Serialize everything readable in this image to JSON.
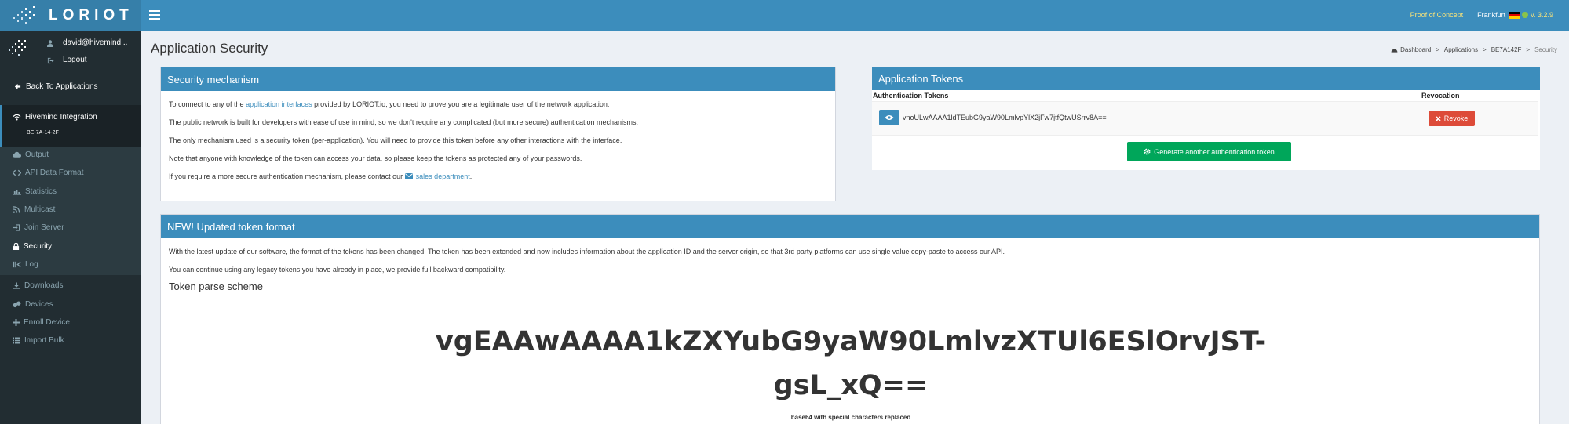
{
  "brand": {
    "name": "LORIOT"
  },
  "topbar": {
    "poc_label": "Proof of Concept",
    "region": "Frankfurt",
    "version": "v. 3.2.9",
    "menu_icon": "hamburger-icon"
  },
  "user": {
    "email": "david@hivemind...",
    "logout_label": "Logout"
  },
  "sidebar": {
    "back_label": "Back To Applications",
    "app_name": "Hivemind Integration",
    "app_id": "BE-7A-14-2F",
    "items": [
      {
        "label": "Output",
        "icon": "cloud-icon"
      },
      {
        "label": "API Data Format",
        "icon": "code-icon"
      },
      {
        "label": "Statistics",
        "icon": "bar-chart-icon"
      },
      {
        "label": "Multicast",
        "icon": "rss-icon"
      },
      {
        "label": "Join Server",
        "icon": "login-icon"
      },
      {
        "label": "Security",
        "icon": "lock-icon"
      },
      {
        "label": "Log",
        "icon": "log-icon"
      },
      {
        "label": "Downloads",
        "icon": "download-icon"
      },
      {
        "label": "Devices",
        "icon": "devices-icon"
      },
      {
        "label": "Enroll Device",
        "icon": "plus-icon"
      },
      {
        "label": "Import Bulk",
        "icon": "list-icon"
      }
    ]
  },
  "page": {
    "title": "Application Security",
    "breadcrumb": [
      "Dashboard",
      "Applications",
      "BE7A142F",
      "Security"
    ]
  },
  "security_box": {
    "title": "Security mechanism",
    "p1_pre": "To connect to any of the ",
    "p1_link": "application interfaces",
    "p1_post": " provided by LORIOT.io, you need to prove you are a legitimate user of the network application.",
    "p2": "The public network is built for developers with ease of use in mind, so we don't require any complicated (but more secure) authentication mechanisms.",
    "p3": "The only mechanism used is a security token (per-application). You will need to provide this token before any other interactions with the interface.",
    "p4": "Note that anyone with knowledge of the token can access your data, so please keep the tokens as protected any of your passwords.",
    "p5_pre": "If you require a more secure authentication mechanism, please contact our ",
    "p5_link": "sales department",
    "p5_post": "."
  },
  "tokens_box": {
    "title": "Application Tokens",
    "col_tokens": "Authentication Tokens",
    "col_revocation": "Revocation",
    "token": "vnoULwAAAA1ldTEubG9yaW90LmlvpYlX2jFw7jtfQtwUSrrv8A==",
    "revoke_label": "Revoke",
    "generate_label": "Generate another authentication token"
  },
  "format_box": {
    "title": "NEW! Updated token format",
    "p1": "With the latest update of our software, the format of the tokens has been changed. The token has been extended and now includes information about the application ID and the server origin, so that 3rd party platforms can use single value copy-paste to access our API.",
    "p2": "You can continue using any legacy tokens you have already in place, we provide full backward compatibility.",
    "scheme_title": "Token parse scheme",
    "token_line1": "vgEAAwAAAA1kZXYubG9yaW90LmlvzXTUl6ESlOrvJST-",
    "token_line2": "gsL_xQ==",
    "token_note": "base64 with special characters replaced"
  }
}
